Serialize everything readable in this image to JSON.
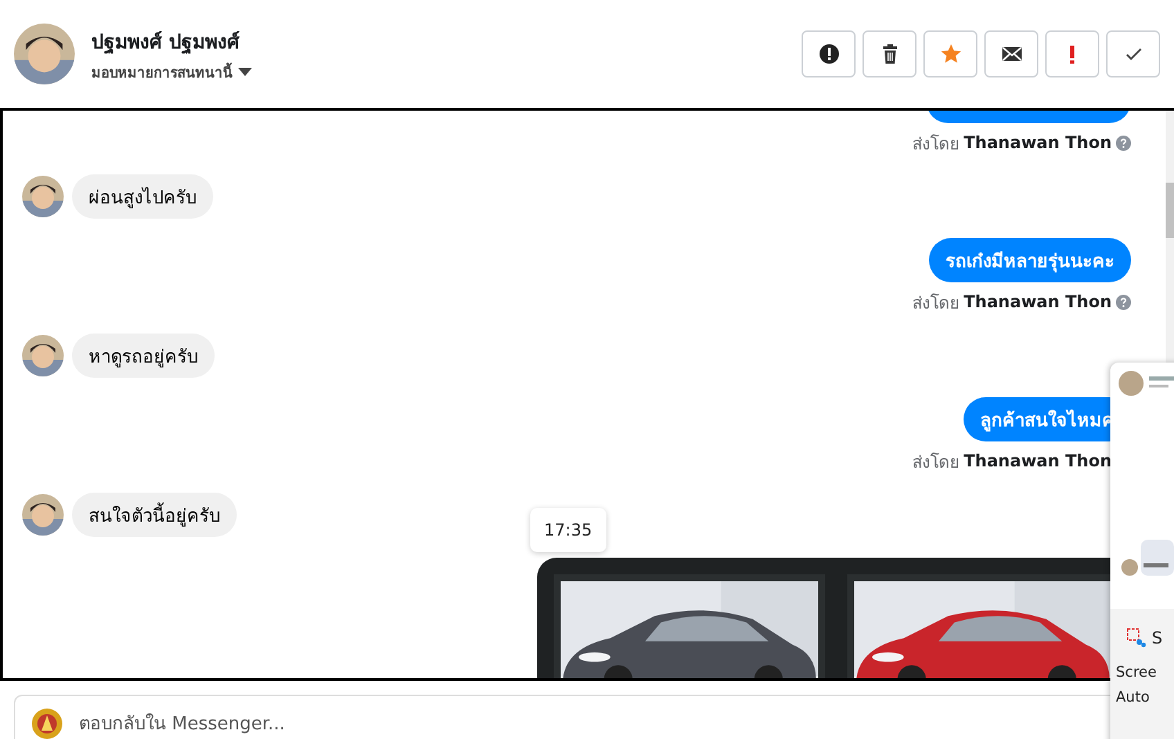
{
  "header": {
    "name": "ปฐมพงศ์ ปฐมพงศ์",
    "subtitle": "มอบหมายการสนทนานี้"
  },
  "toolbar": [
    {
      "kind": "alert"
    },
    {
      "kind": "trash"
    },
    {
      "kind": "star"
    },
    {
      "kind": "mail"
    },
    {
      "kind": "important"
    },
    {
      "kind": "done"
    }
  ],
  "messages": [
    {
      "kind": "outgoing_cut"
    },
    {
      "kind": "sent_by",
      "prefix": "ส่งโดย",
      "sender": "Thanawan Thon",
      "help": true
    },
    {
      "kind": "incoming",
      "text": "ผ่อนสูงไปครับ"
    },
    {
      "kind": "outgoing",
      "text": "รถเก๋งมีหลายรุ่นนะคะ"
    },
    {
      "kind": "sent_by",
      "prefix": "ส่งโดย",
      "sender": "Thanawan Thon",
      "help": true
    },
    {
      "kind": "incoming",
      "text": "หาดูรถอยู่ครับ"
    },
    {
      "kind": "outgoing",
      "text": "ลูกค้าสนใจไหมค"
    },
    {
      "kind": "sent_by",
      "prefix": "ส่งโดย",
      "sender": "Thanawan Thon"
    },
    {
      "kind": "incoming",
      "text": "สนใจตัวนี้อยู่ครับ"
    },
    {
      "kind": "carousel"
    }
  ],
  "tooltip": {
    "text": "17:35"
  },
  "reply": {
    "placeholder": "ตอบกลับใน Messenger..."
  },
  "popup": {
    "app_label": "S",
    "lines": [
      "Scree",
      "Auto"
    ]
  }
}
